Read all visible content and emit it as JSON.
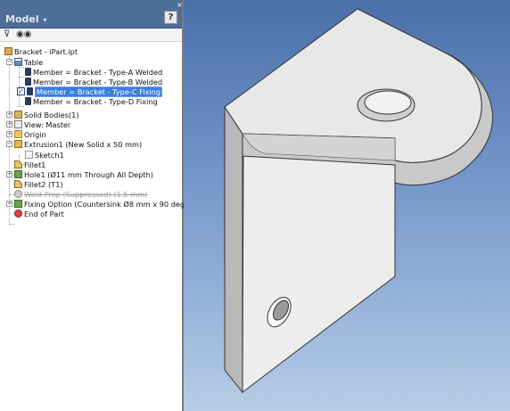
{
  "panel": {
    "title": "Model",
    "help_label": "?",
    "close_label": "×"
  },
  "toolbar": {
    "filter_icon": "filter-icon",
    "find_icon": "binoculars-icon"
  },
  "tree": {
    "root": "Bracket - iPart.ipt",
    "table": "Table",
    "members": [
      "Member = Bracket - Type-A Welded",
      "Member = Bracket - Type-B Welded",
      "Member = Bracket - Type-C Fixing",
      "Member = Bracket - Type-D Fixing"
    ],
    "selected_member_index": 2,
    "solid_bodies": "Solid Bodies(1)",
    "view": "View: Master",
    "origin": "Origin",
    "extrusion": "Extrusion1 (New Solid x 50 mm)",
    "sketch": "Sketch1",
    "fillet1": "Fillet1",
    "hole": "Hole1 (Ø11 mm Through All Depth)",
    "fillet2": "Fillet2 (T1)",
    "weld_prep": "Weld Prep (Suppressed) (1.5 mm)",
    "fixing_option": "Fixing Option (Countersink Ø8 mm x 90 deg, Ø5",
    "end_of_part": "End of Part"
  },
  "colors": {
    "panel_header": "#4e6e9a",
    "selection": "#3a7ee0",
    "viewport_top": "#4b6fa8",
    "viewport_bottom": "#b8cde6",
    "part_face": "#e6e6e6"
  }
}
